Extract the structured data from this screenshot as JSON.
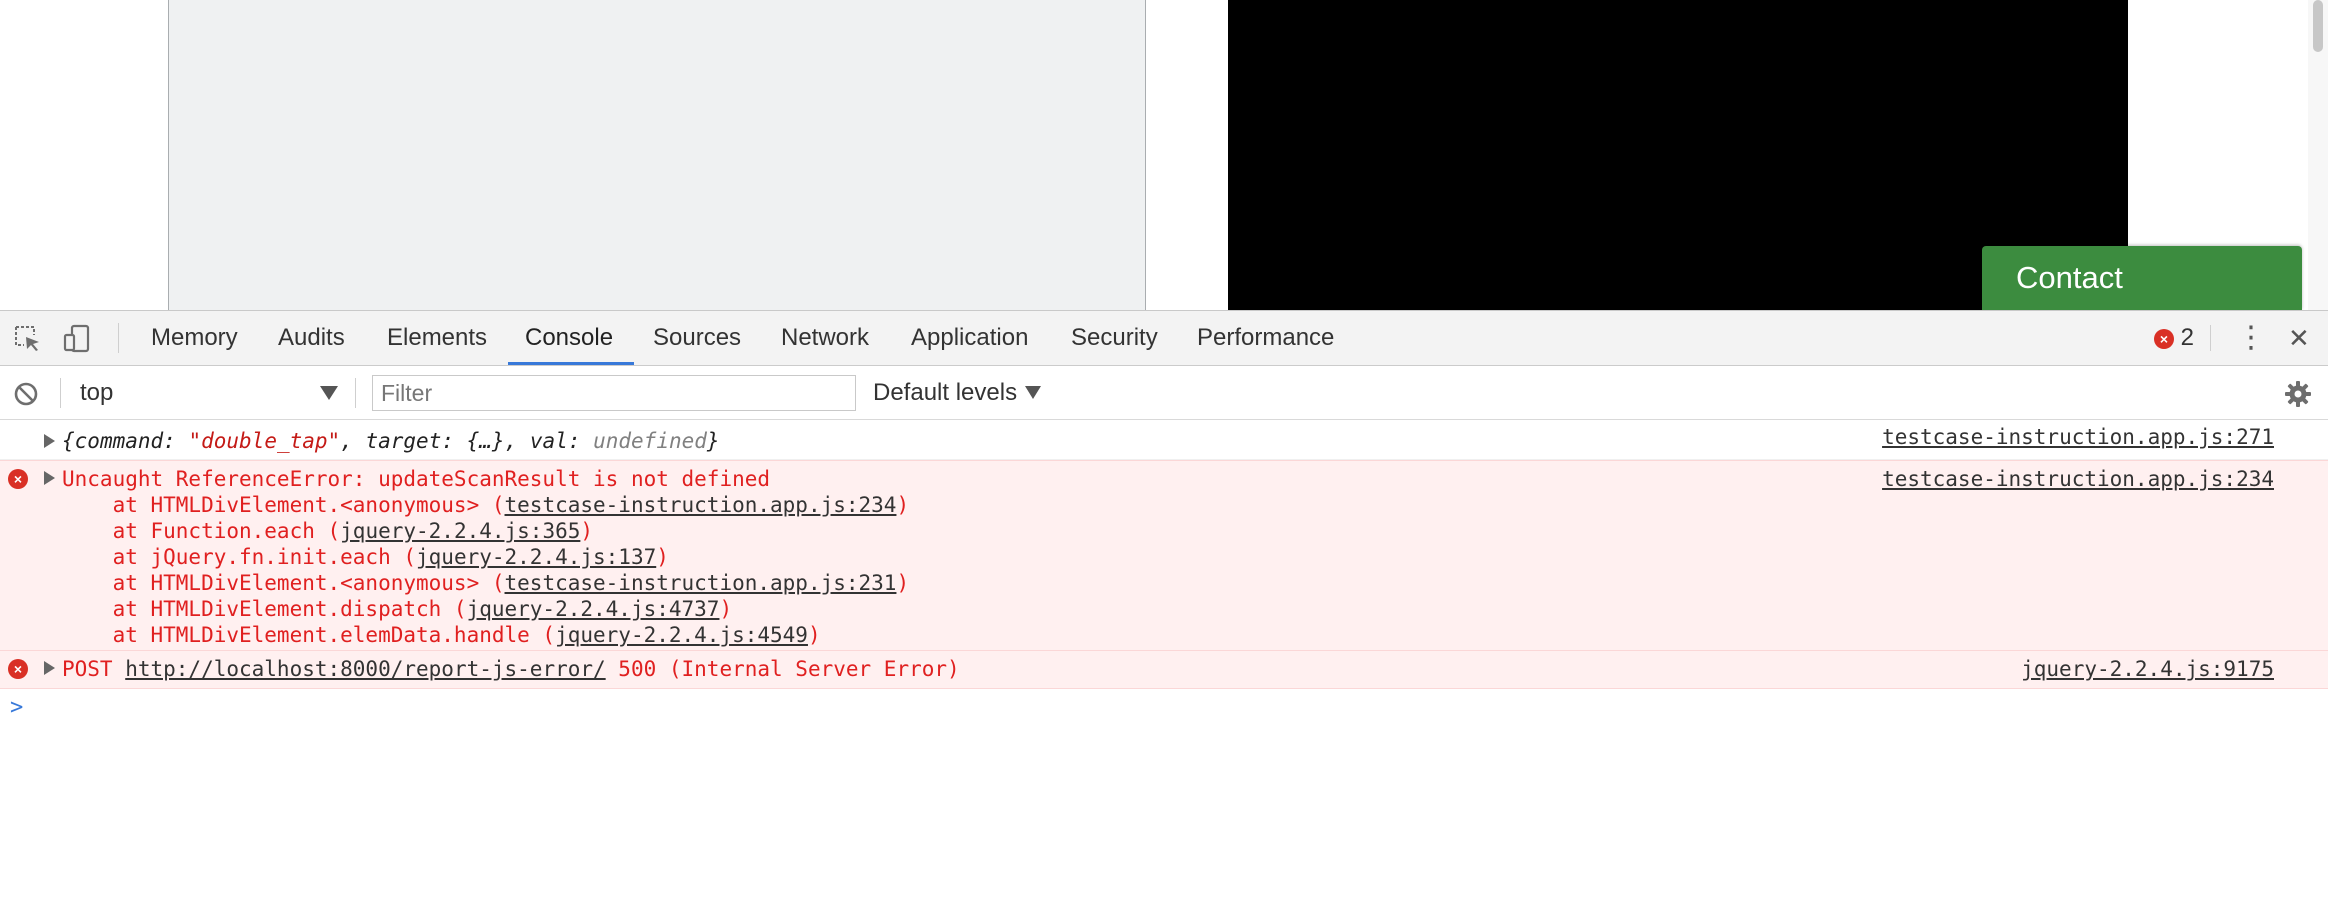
{
  "viewport": {
    "contact_label": "Contact"
  },
  "devtools": {
    "tabs": [
      {
        "label": "Memory",
        "active": false
      },
      {
        "label": "Audits",
        "active": false
      },
      {
        "label": "Elements",
        "active": false
      },
      {
        "label": "Console",
        "active": true
      },
      {
        "label": "Sources",
        "active": false
      },
      {
        "label": "Network",
        "active": false
      },
      {
        "label": "Application",
        "active": false
      },
      {
        "label": "Security",
        "active": false
      },
      {
        "label": "Performance",
        "active": false
      }
    ],
    "error_icon_glyph": "×",
    "error_count": "2",
    "menu_glyph": "⋮",
    "close_glyph": "✕",
    "accent_color": "#3879d9",
    "error_color": "#d93025"
  },
  "filterbar": {
    "context": "top",
    "filter_placeholder": "Filter",
    "filter_value": "",
    "levels": "Default levels"
  },
  "messages": {
    "log": {
      "open": "{",
      "k1": "command",
      "v1": "\"double_tap\"",
      "k2": "target",
      "v2": "{…}",
      "k3": "val",
      "v3": "undefined",
      "close": "}",
      "sep": ": ",
      "comma": ", ",
      "source": "testcase-instruction.app.js:271"
    },
    "error1": {
      "message": "Uncaught ReferenceError: updateScanResult is not defined",
      "source": "testcase-instruction.app.js:234",
      "stack": [
        {
          "prefix": "    at HTMLDivElement.<anonymous> (",
          "link": "testcase-instruction.app.js:234",
          "suffix": ")"
        },
        {
          "prefix": "    at Function.each (",
          "link": "jquery-2.2.4.js:365",
          "suffix": ")"
        },
        {
          "prefix": "    at jQuery.fn.init.each (",
          "link": "jquery-2.2.4.js:137",
          "suffix": ")"
        },
        {
          "prefix": "    at HTMLDivElement.<anonymous> (",
          "link": "testcase-instruction.app.js:231",
          "suffix": ")"
        },
        {
          "prefix": "    at HTMLDivElement.dispatch (",
          "link": "jquery-2.2.4.js:4737",
          "suffix": ")"
        },
        {
          "prefix": "    at HTMLDivElement.elemData.handle (",
          "link": "jquery-2.2.4.js:4549",
          "suffix": ")"
        }
      ]
    },
    "error2": {
      "method": "POST ",
      "url": "http://localhost:8000/report-js-error/",
      "status": " 500 (Internal Server Error)",
      "source": "jquery-2.2.4.js:9175"
    },
    "prompt_glyph": ">",
    "error_icon_glyph": "×"
  }
}
